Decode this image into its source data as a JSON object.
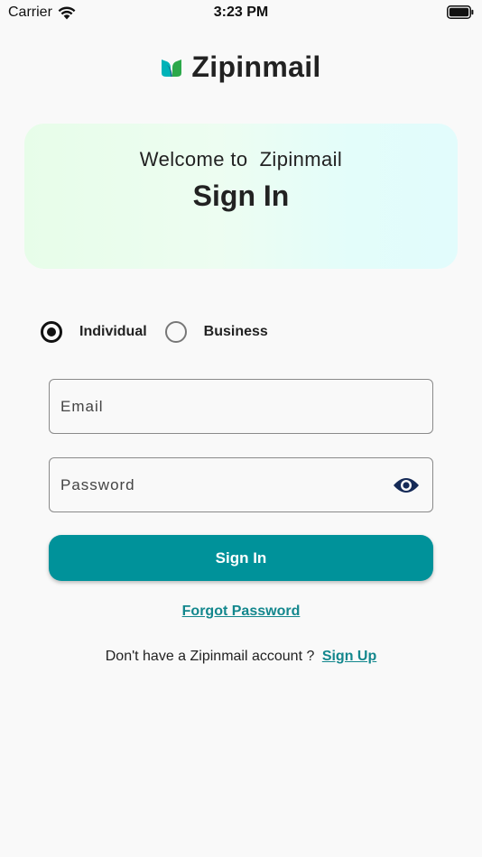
{
  "status_bar": {
    "carrier": "Carrier",
    "time": "3:23 PM"
  },
  "brand": {
    "name": "Zipinmail",
    "logo_icon": "leaf-logo-icon"
  },
  "welcome": {
    "line": "Welcome to  Zipinmail",
    "title": "Sign In"
  },
  "account_type": {
    "options": [
      {
        "label": "Individual",
        "selected": true
      },
      {
        "label": "Business",
        "selected": false
      }
    ]
  },
  "form": {
    "email_placeholder": "Email",
    "email_value": "",
    "password_placeholder": "Password",
    "password_value": "",
    "password_toggle_icon": "eye-icon",
    "submit_label": "Sign In",
    "forgot_label": "Forgot Password"
  },
  "signup": {
    "prompt": "Don't have a Zipinmail account ?",
    "link_label": "Sign Up"
  },
  "colors": {
    "accent": "#00929a",
    "link": "#13878d",
    "background": "#f9f9f9",
    "eye_icon": "#152a57"
  }
}
